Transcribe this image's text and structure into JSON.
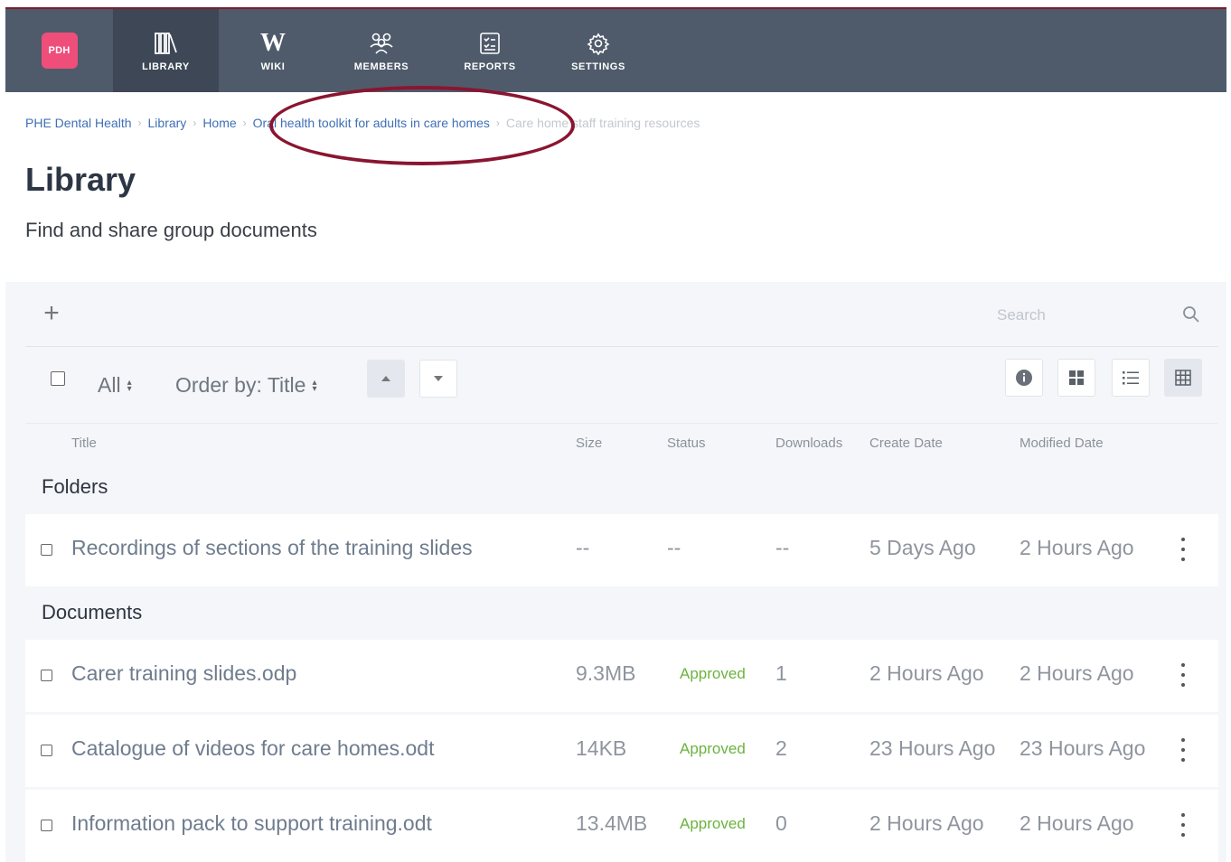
{
  "nav": {
    "logo_text": "PDH",
    "items": [
      {
        "label": "LIBRARY",
        "icon": "library-icon",
        "active": true
      },
      {
        "label": "WIKI",
        "icon": "wiki-icon",
        "glyph": "W"
      },
      {
        "label": "MEMBERS",
        "icon": "members-icon"
      },
      {
        "label": "REPORTS",
        "icon": "reports-icon"
      },
      {
        "label": "SETTINGS",
        "icon": "settings-icon"
      }
    ],
    "bar_color": "#4f5b6b",
    "logo_color": "#ef4e7b"
  },
  "breadcrumb": [
    {
      "label": "PHE Dental Health"
    },
    {
      "label": "Library"
    },
    {
      "label": "Home"
    },
    {
      "label": "Oral health toolkit for adults in care homes"
    },
    {
      "label": "Care home staff training resources"
    }
  ],
  "page": {
    "title": "Library",
    "subtitle": "Find and share group documents"
  },
  "toolbar": {
    "add_label": "+",
    "search_placeholder": "Search",
    "filter_label": "All",
    "order_label": "Order by: Title"
  },
  "columns": {
    "title": "Title",
    "size": "Size",
    "status": "Status",
    "downloads": "Downloads",
    "create_date": "Create Date",
    "modified_date": "Modified Date"
  },
  "sections": {
    "folders": "Folders",
    "documents": "Documents"
  },
  "folders": [
    {
      "title": "Recordings of sections of the training slides",
      "size": "--",
      "status": "--",
      "downloads": "--",
      "create_date": "5 Days Ago",
      "modified_date": "2 Hours Ago"
    }
  ],
  "documents": [
    {
      "title": "Carer training slides.odp",
      "size": "9.3MB",
      "status": "Approved",
      "downloads": "1",
      "create_date": "2 Hours Ago",
      "modified_date": "2 Hours Ago"
    },
    {
      "title": "Catalogue of videos for care homes.odt",
      "size": "14KB",
      "status": "Approved",
      "downloads": "2",
      "create_date": "23 Hours Ago",
      "modified_date": "23 Hours Ago"
    },
    {
      "title": "Information pack to support training.odt",
      "size": "13.4MB",
      "status": "Approved",
      "downloads": "0",
      "create_date": "2 Hours Ago",
      "modified_date": "2 Hours Ago"
    }
  ],
  "colors": {
    "link": "#3f6fb6",
    "approved": "#6cb33f",
    "annotation": "#8a1530"
  }
}
